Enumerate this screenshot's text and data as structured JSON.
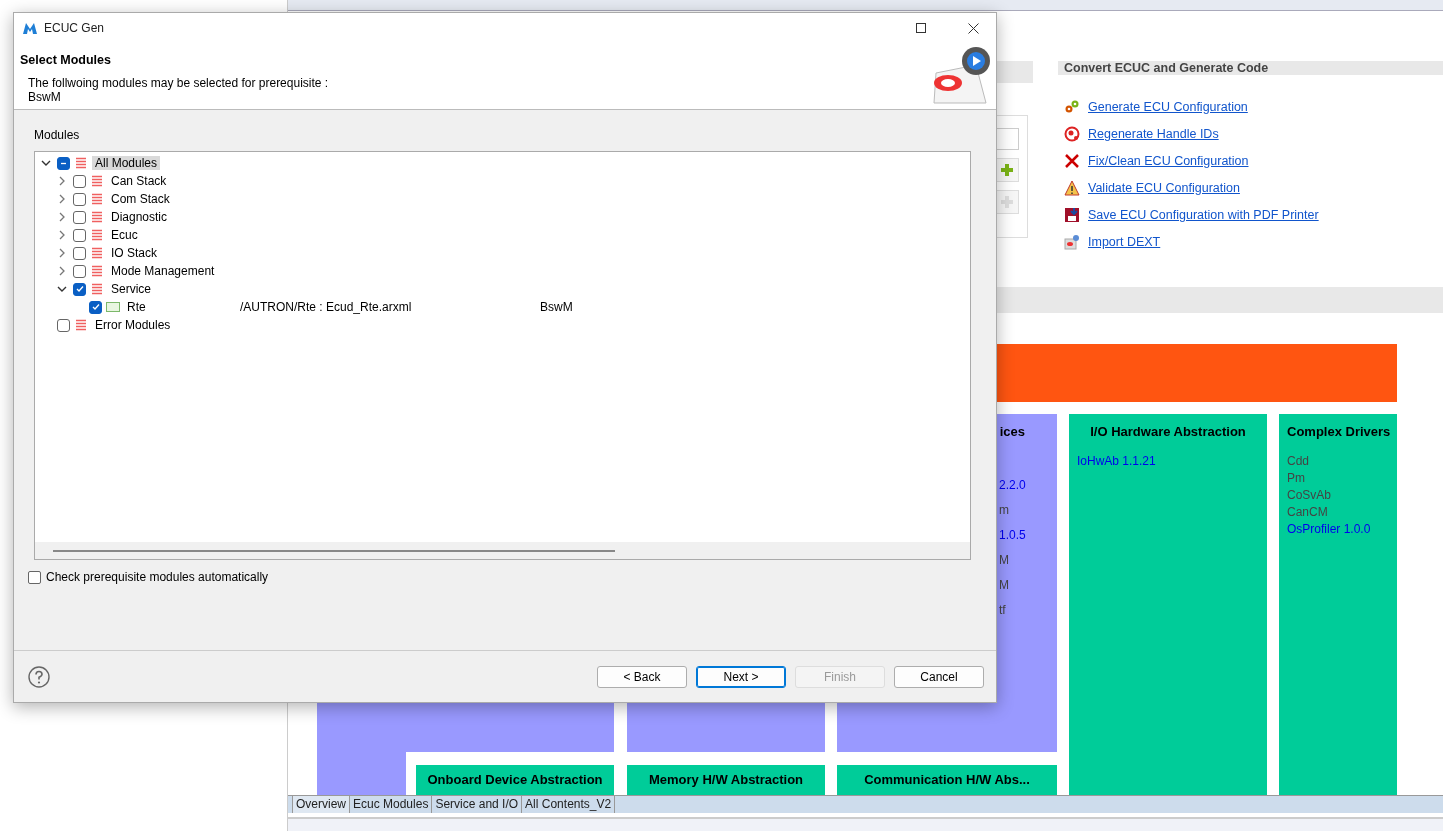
{
  "editor": {
    "convert_section": {
      "title": "Convert ECUC and Generate Code",
      "links": [
        {
          "label": "Generate ECU Configuration",
          "kind": "gears"
        },
        {
          "label": "Regenerate Handle IDs",
          "kind": "regen"
        },
        {
          "label": "Fix/Clean ECU Configuration",
          "kind": "fix"
        },
        {
          "label": "Validate ECU Configuration",
          "kind": "warn"
        },
        {
          "label": "Save ECU Configuration with PDF Printer",
          "kind": "save"
        },
        {
          "label": "Import DEXT",
          "kind": "import"
        }
      ]
    },
    "diagram": {
      "services": {
        "title": "ices",
        "items": [
          {
            "text": "2.2.0",
            "link": true
          },
          {
            "text": "m",
            "link": false
          },
          {
            "text": "1.0.5",
            "link": true
          },
          {
            "text": "M",
            "link": false
          },
          {
            "text": "M",
            "link": false
          },
          {
            "text": "tf",
            "link": false
          }
        ]
      },
      "io_hw": {
        "title": "I/O Hardware Abstraction",
        "items": [
          {
            "text": "IoHwAb 1.1.21",
            "link": true
          }
        ]
      },
      "complex": {
        "title": "Complex Drivers",
        "items": [
          {
            "text": "Cdd",
            "link": false
          },
          {
            "text": "Pm",
            "link": false
          },
          {
            "text": "CoSvAb",
            "link": false
          },
          {
            "text": "CanCM",
            "link": false
          },
          {
            "text": "OsProfiler 1.0.0",
            "link": true
          }
        ]
      },
      "bottom_blocks": [
        "Onboard Device Abstraction",
        "Memory H/W Abstraction",
        "Communication H/W Abs..."
      ]
    },
    "tabs": [
      {
        "label": "Overview",
        "selected": true
      },
      {
        "label": "Ecuc Modules",
        "selected": false
      },
      {
        "label": "Service and I/O",
        "selected": false
      },
      {
        "label": "All Contents_V2",
        "selected": false
      }
    ]
  },
  "dialog": {
    "title": "ECUC Gen",
    "heading": "Select Modules",
    "description": "The follwoing modules may be selected for prerequisite :",
    "module": "BswM",
    "tree_label": "Modules",
    "tree": [
      {
        "label": "All Modules",
        "kind": "group",
        "indeterminate": true,
        "expanded": true,
        "selected": true,
        "children": [
          {
            "label": "Can Stack",
            "kind": "group",
            "checked": false,
            "expanded": false,
            "selected": false
          },
          {
            "label": "Com Stack",
            "kind": "group",
            "checked": false,
            "expanded": false,
            "selected": false
          },
          {
            "label": "Diagnostic",
            "kind": "group",
            "checked": false,
            "expanded": false,
            "selected": false
          },
          {
            "label": "Ecuc",
            "kind": "group",
            "checked": false,
            "expanded": false,
            "selected": false
          },
          {
            "label": "IO Stack",
            "kind": "group",
            "checked": false,
            "expanded": false,
            "selected": false
          },
          {
            "label": "Mode Management",
            "kind": "group",
            "checked": false,
            "expanded": false,
            "selected": false
          },
          {
            "label": "Service",
            "kind": "group",
            "checked": true,
            "expanded": true,
            "selected": false,
            "children": [
              {
                "label": "Rte",
                "kind": "module",
                "checked": true,
                "selected": false,
                "path": "/AUTRON/Rte : Ecud_Rte.arxml",
                "owner": "BswM"
              }
            ]
          }
        ]
      },
      {
        "label": "Error Modules",
        "kind": "group",
        "checked": false,
        "selected": false
      }
    ],
    "auto_check": {
      "label": "Check prerequisite modules automatically",
      "checked": false
    },
    "buttons": [
      {
        "label": "< Back",
        "disabled": false,
        "default": false
      },
      {
        "label": "Next >",
        "disabled": false,
        "default": true
      },
      {
        "label": "Finish",
        "disabled": true,
        "default": false
      },
      {
        "label": "Cancel",
        "disabled": false,
        "default": false
      }
    ]
  }
}
